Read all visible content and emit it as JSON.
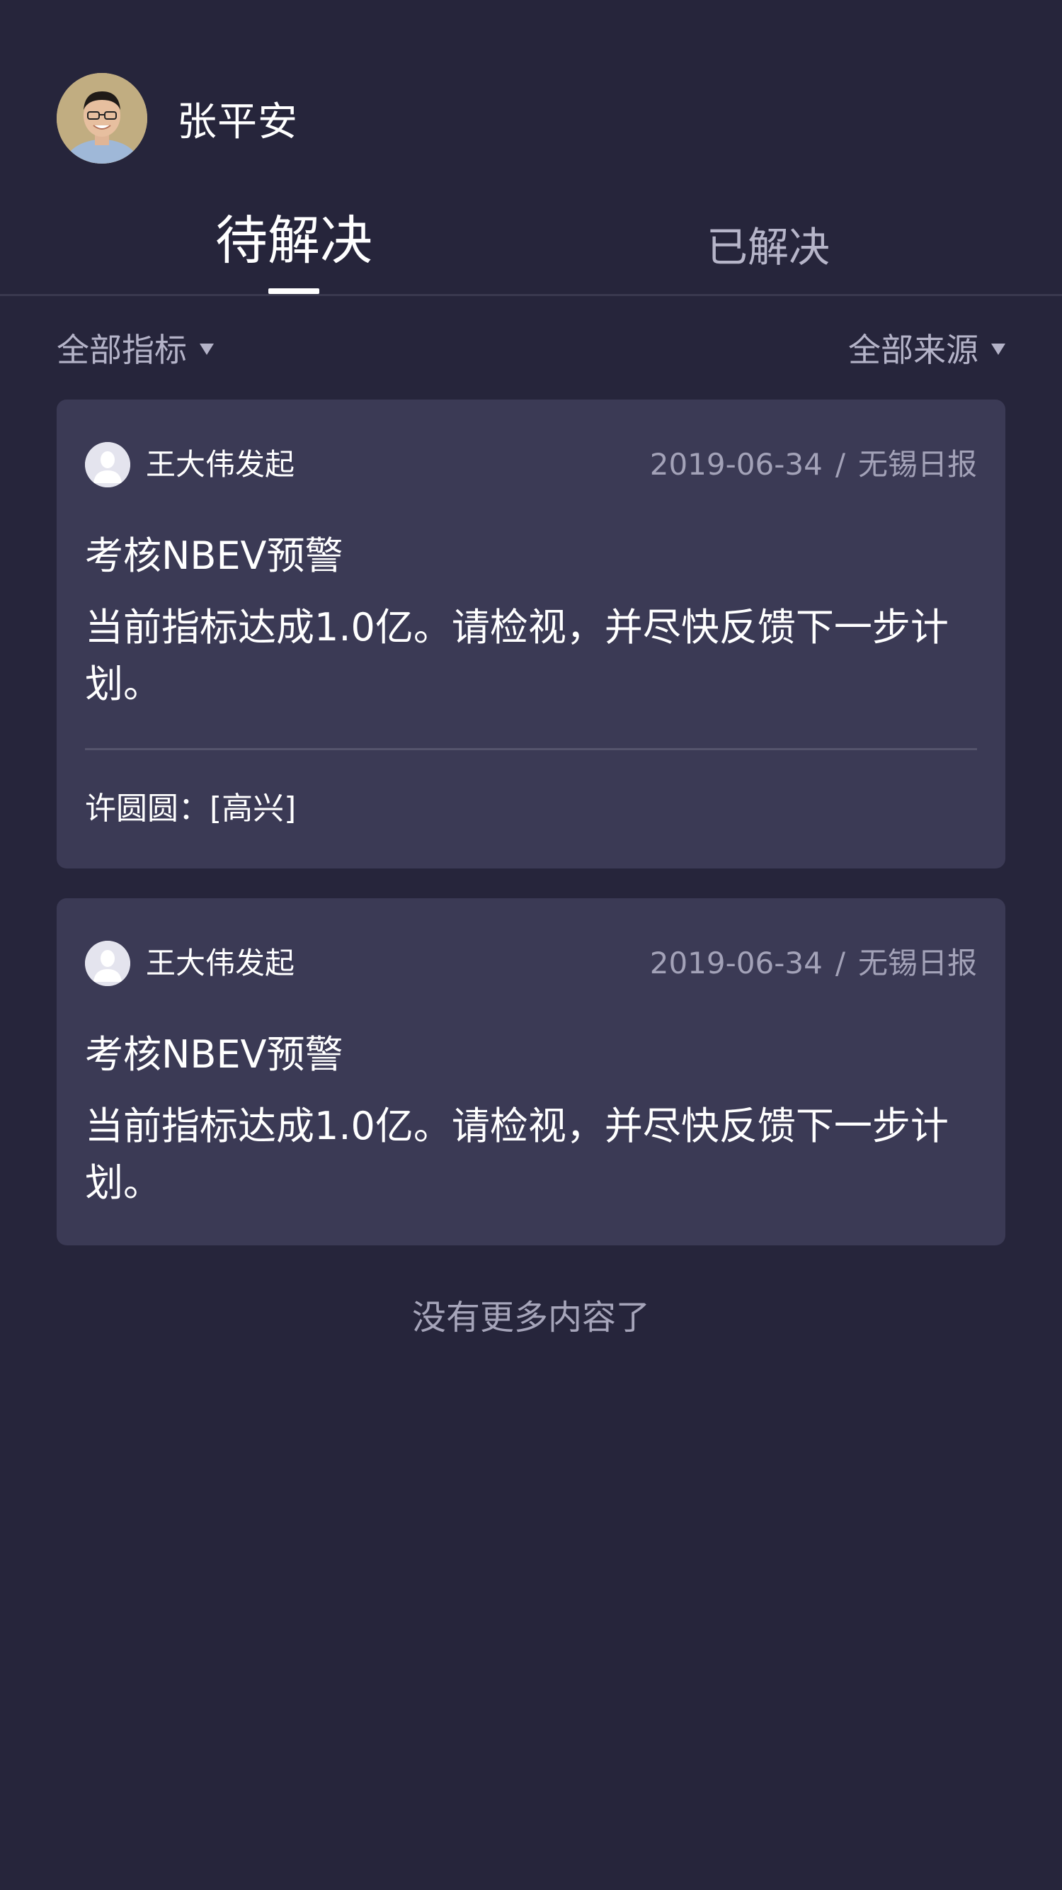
{
  "header": {
    "username": "张平安",
    "avatar_icon": "user-photo-avatar"
  },
  "tabs": [
    {
      "label": "待解决",
      "active": true
    },
    {
      "label": "已解决",
      "active": false
    }
  ],
  "filters": {
    "left": {
      "label": "全部指标",
      "icon": "caret-down-icon"
    },
    "right": {
      "label": "全部来源",
      "icon": "caret-down-icon"
    }
  },
  "cards": [
    {
      "initiator": "王大伟发起",
      "date": "2019-06-34",
      "separator": "/",
      "source": "无锡日报",
      "title": "考核NBEV预警",
      "body": "当前指标达成1.0亿。请检视，并尽快反馈下一步计划。",
      "comment": "许圆圆：[高兴]"
    },
    {
      "initiator": "王大伟发起",
      "date": "2019-06-34",
      "separator": "/",
      "source": "无锡日报",
      "title": "考核NBEV预警",
      "body": "当前指标达成1.0亿。请检视，并尽快反馈下一步计划。"
    }
  ],
  "footer": {
    "end_text": "没有更多内容了"
  },
  "colors": {
    "background": "#26253b",
    "card": "#3b3a55",
    "muted_text": "#a3a2b8"
  }
}
